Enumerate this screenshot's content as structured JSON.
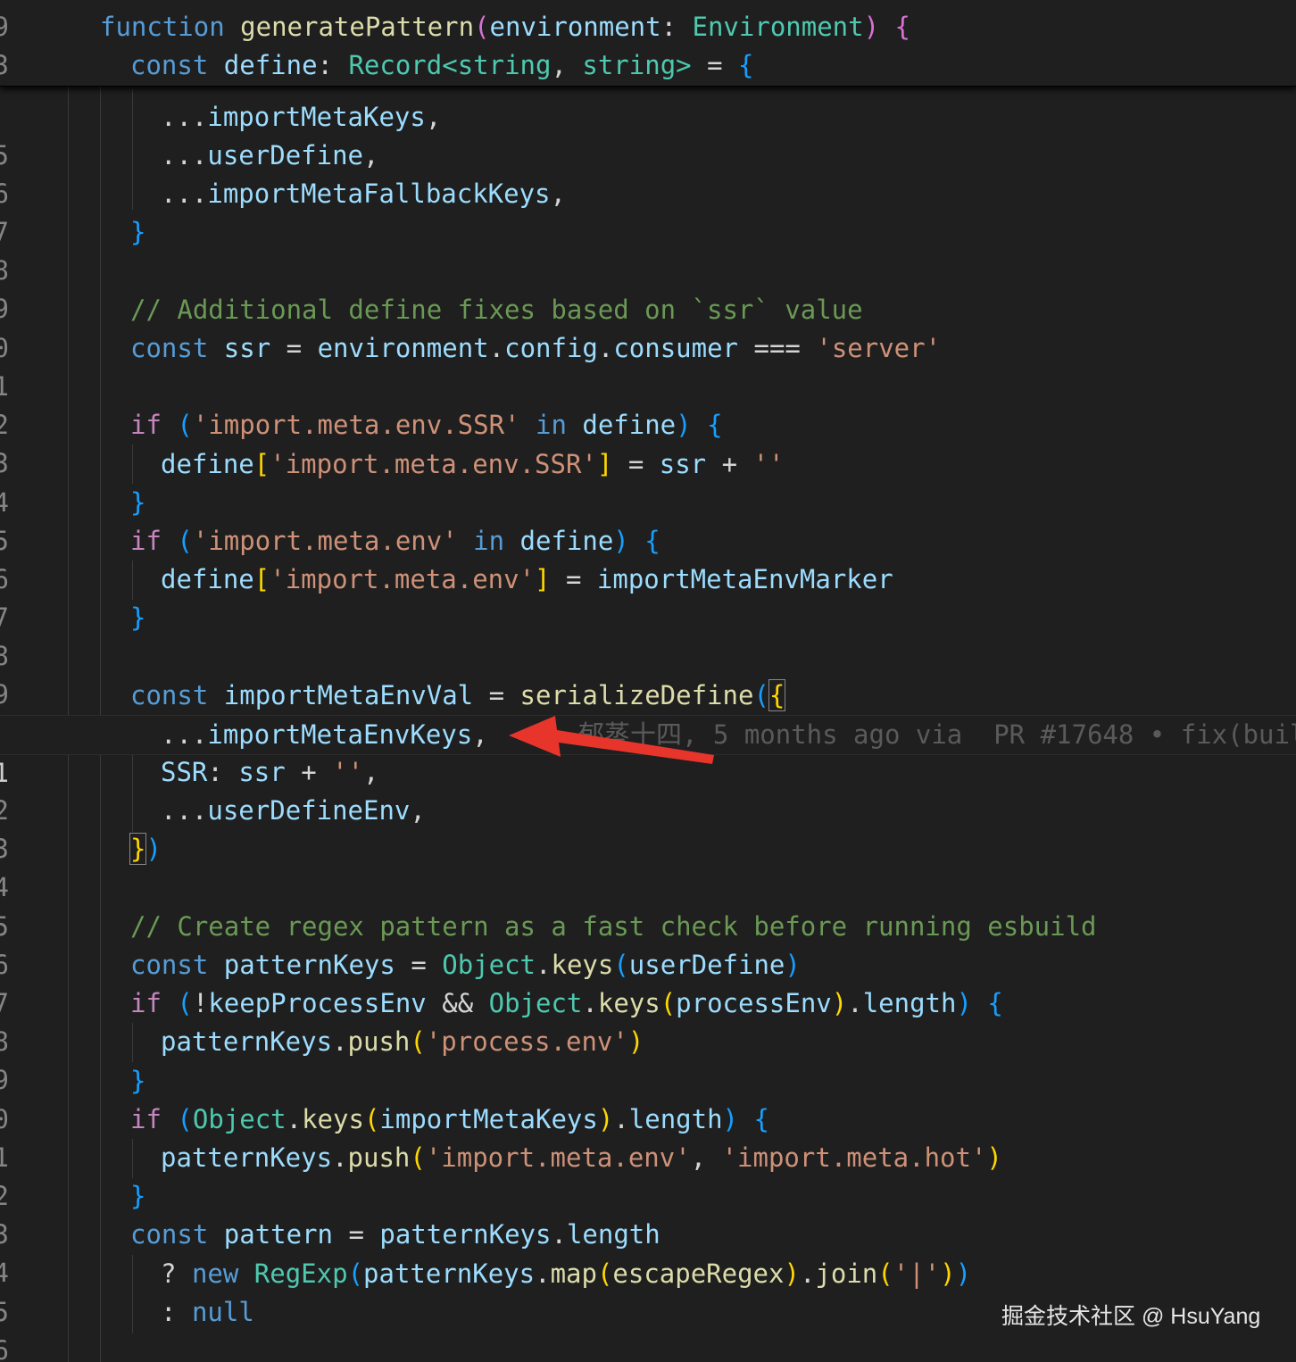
{
  "sticky": {
    "line1": {
      "num": "9",
      "text_function": "function",
      "text_name": "generatePattern",
      "text_param": "environment",
      "text_type": "Environment"
    },
    "line2": {
      "num": "3",
      "text_const": "const",
      "text_name": "define",
      "text_record": "Record",
      "text_string1": "string",
      "text_string2": "string"
    }
  },
  "lines": [
    {
      "num": "5",
      "parts": [
        "...",
        "importMetaKeys",
        ","
      ]
    },
    {
      "num": "6",
      "parts": [
        "...",
        "userDefine",
        ","
      ]
    },
    {
      "num": "7",
      "parts": [
        "...",
        "importMetaFallbackKeys",
        ","
      ]
    },
    {
      "num": "8",
      "parts": [
        "}"
      ]
    },
    {
      "num": "9",
      "parts": []
    },
    {
      "num": "0",
      "parts": [
        "// Additional define fixes based on `ssr` value"
      ]
    },
    {
      "num": "1",
      "parts": [
        "const",
        "ssr",
        "=",
        "environment",
        ".",
        "config",
        ".",
        "consumer",
        "===",
        "'server'"
      ]
    },
    {
      "num": "2",
      "parts": []
    },
    {
      "num": "3",
      "parts": [
        "if",
        "(",
        "'import.meta.env.SSR'",
        "in",
        "define",
        ")",
        "{"
      ]
    },
    {
      "num": "4",
      "parts": [
        "define",
        "[",
        "'import.meta.env.SSR'",
        "]",
        "=",
        "ssr",
        "+",
        "''"
      ]
    },
    {
      "num": "5",
      "parts": [
        "}"
      ]
    },
    {
      "num": "6",
      "parts": [
        "if",
        "(",
        "'import.meta.env'",
        "in",
        "define",
        ")",
        "{"
      ]
    },
    {
      "num": "7",
      "parts": [
        "define",
        "[",
        "'import.meta.env'",
        "]",
        "=",
        "importMetaEnvMarker"
      ]
    },
    {
      "num": "8",
      "parts": [
        "}"
      ]
    },
    {
      "num": "9",
      "parts": []
    },
    {
      "num": "0",
      "parts": [
        "const",
        "importMetaEnvVal",
        "=",
        "serializeDefine",
        "(",
        "{"
      ]
    },
    {
      "num": "1",
      "parts": [
        "...",
        "importMetaEnvKeys",
        ","
      ]
    },
    {
      "num": "2",
      "parts": [
        "SSR",
        ":",
        "ssr",
        "+",
        "''",
        ","
      ]
    },
    {
      "num": "3",
      "parts": [
        "...",
        "userDefineEnv",
        ","
      ]
    },
    {
      "num": "4",
      "parts": [
        "}",
        ")"
      ]
    },
    {
      "num": "5",
      "parts": []
    },
    {
      "num": "6",
      "parts": [
        "// Create regex pattern as a fast check before running esbuild"
      ]
    },
    {
      "num": "7",
      "parts": [
        "const",
        "patternKeys",
        "=",
        "Object",
        ".",
        "keys",
        "(",
        "userDefine",
        ")"
      ]
    },
    {
      "num": "8",
      "parts": [
        "if",
        "(",
        "!",
        "keepProcessEnv",
        "&&",
        "Object",
        ".",
        "keys",
        "(",
        "processEnv",
        ")",
        ".",
        "length",
        ")",
        "{"
      ]
    },
    {
      "num": "9",
      "parts": [
        "patternKeys",
        ".",
        "push",
        "(",
        "'process.env'",
        ")"
      ]
    },
    {
      "num": "0",
      "parts": [
        "}"
      ]
    },
    {
      "num": "1",
      "parts": [
        "if",
        "(",
        "Object",
        ".",
        "keys",
        "(",
        "importMetaKeys",
        ")",
        ".",
        "length",
        ")",
        "{"
      ]
    },
    {
      "num": "2",
      "parts": [
        "patternKeys",
        ".",
        "push",
        "(",
        "'import.meta.env'",
        ",",
        "'import.meta.hot'",
        ")"
      ]
    },
    {
      "num": "3",
      "parts": [
        "}"
      ]
    },
    {
      "num": "4",
      "parts": [
        "const",
        "pattern",
        "=",
        "patternKeys",
        ".",
        "length"
      ]
    },
    {
      "num": "5",
      "parts": [
        "?",
        "new",
        "RegExp",
        "(",
        "patternKeys",
        ".",
        "map",
        "(",
        "escapeRegex",
        ")",
        ".",
        "join",
        "(",
        "'|'",
        ")",
        ")"
      ]
    },
    {
      "num": "6",
      "parts": [
        ":",
        "null"
      ]
    },
    {
      "num": "7",
      "parts": []
    }
  ],
  "blame": "郁蒸十四, 5 months ago via  PR #17648 • fix(buil",
  "watermark": "掘金技术社区 @ HsuYang",
  "colors": {
    "background": "#1f1f1f",
    "keyword": "#569cd6",
    "control": "#c586c0",
    "function": "#dcdcaa",
    "type": "#4ec9b0",
    "variable": "#9cdcfe",
    "string": "#ce9178",
    "comment": "#6a9955",
    "arrow": "#e8352b"
  }
}
